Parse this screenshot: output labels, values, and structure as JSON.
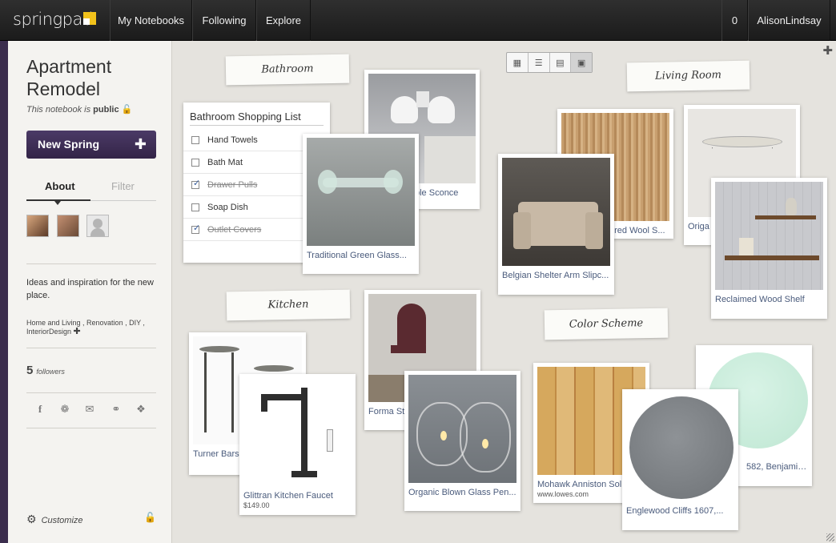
{
  "nav": {
    "logo": "springpad",
    "items": [
      "My Notebooks",
      "Following",
      "Explore"
    ],
    "count": "0",
    "user": "AlisonLindsay"
  },
  "sidebar": {
    "title": "Apartment Remodel",
    "visibility_prefix": "This notebook is",
    "visibility": "public",
    "new_spring": "New Spring",
    "tabs": [
      "About",
      "Filter"
    ],
    "description": "Ideas and inspiration for the new place.",
    "tags": "Home and Living , Renovation , DIY , InteriorDesign",
    "followers_count": "5",
    "followers_label": "followers",
    "customize": "Customize"
  },
  "board": {
    "labels": [
      "Bathroom",
      "Living Room",
      "Kitchen",
      "Color Scheme"
    ],
    "shopping_list": {
      "title": "Bathroom Shopping List",
      "items": [
        {
          "text": "Hand Towels",
          "checked": false
        },
        {
          "text": "Bath Mat",
          "checked": false
        },
        {
          "text": "Drawer Pulls",
          "checked": true
        },
        {
          "text": "Soap Dish",
          "checked": false
        },
        {
          "text": "Outlet Covers",
          "checked": true
        }
      ]
    },
    "cards": [
      {
        "caption": "ble Sconce"
      },
      {
        "caption": "Traditional Green Glass..."
      },
      {
        "caption": "ured Wool S..."
      },
      {
        "caption": "Belgian Shelter Arm Slipc..."
      },
      {
        "caption": "Origa"
      },
      {
        "caption": "Reclaimed Wood Shelf"
      },
      {
        "caption": "Turner Bars"
      },
      {
        "caption": "Glittran Kitchen Faucet",
        "sub": "$149.00"
      },
      {
        "caption": "Forma St"
      },
      {
        "caption": "Organic Blown Glass Pen..."
      },
      {
        "caption": "Mohawk Anniston Sol",
        "sub": "www.lowes.com"
      },
      {
        "caption": "Englewood Cliffs 1607,..."
      },
      {
        "caption": "582, Benjamin ..."
      }
    ]
  }
}
